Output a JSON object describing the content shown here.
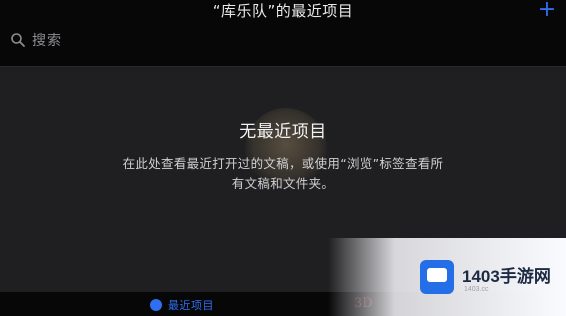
{
  "header": {
    "title": "“库乐队”的最近项目",
    "add_symbol": "+"
  },
  "search": {
    "placeholder": "搜索"
  },
  "empty_state": {
    "title": "无最近项目",
    "description": "在此处查看最近打开过的文稿，或使用“浏览”标签查看所有文稿和文件夹。"
  },
  "bottom_tabs": {
    "recent_label": "最近项目",
    "mark": "3D"
  },
  "watermark": {
    "name": "1403手游网",
    "url": "1403.cc"
  },
  "colors": {
    "accent": "#2f6ff0",
    "background": "#1f1f21",
    "bar": "#070708"
  }
}
